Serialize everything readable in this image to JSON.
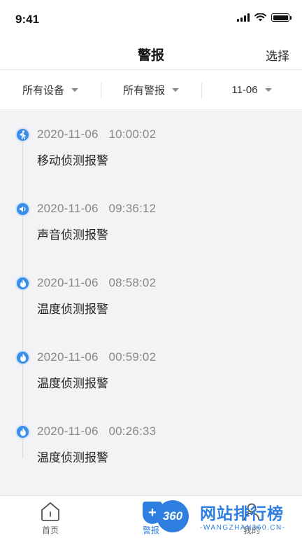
{
  "status_bar": {
    "time": "9:41"
  },
  "header": {
    "title": "警报",
    "action_label": "选择"
  },
  "filters": [
    {
      "label": "所有设备"
    },
    {
      "label": "所有警报"
    },
    {
      "label": "11-06"
    }
  ],
  "alarms": [
    {
      "datetime": "2020-11-06   10:00:02",
      "type": "移动侦测报警",
      "icon": "motion-person-icon"
    },
    {
      "datetime": "2020-11-06   09:36:12",
      "type": "声音侦测报警",
      "icon": "sound-speaker-icon"
    },
    {
      "datetime": "2020-11-06   08:58:02",
      "type": "温度侦测报警",
      "icon": "flame-icon"
    },
    {
      "datetime": "2020-11-06   00:59:02",
      "type": "温度侦测报警",
      "icon": "flame-icon"
    },
    {
      "datetime": "2020-11-06   00:26:33",
      "type": "温度侦测报警",
      "icon": "flame-icon"
    }
  ],
  "tab_bar": {
    "tabs": [
      {
        "label": "首页",
        "icon": "home-icon"
      },
      {
        "label": "警报",
        "icon": "alarm-icon"
      },
      {
        "label": "我的",
        "icon": "profile-icon"
      }
    ]
  },
  "watermark": {
    "badge": "360",
    "title": "网站排行榜",
    "url": "-WANGZHAN360.CN-"
  },
  "colors": {
    "accent": "#2f7fe0",
    "alarm_icon": "#3a8de8",
    "list_bg": "#f3f3f5"
  }
}
